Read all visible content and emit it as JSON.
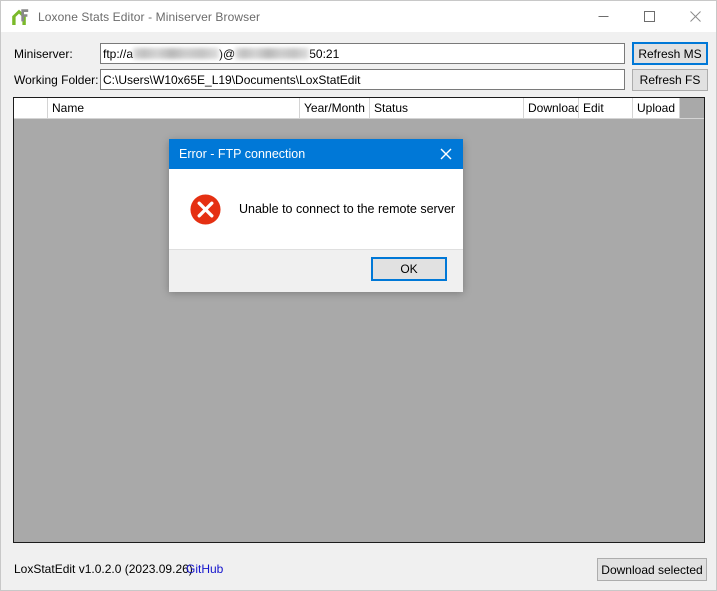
{
  "window": {
    "title": "Loxone Stats Editor - Miniserver Browser",
    "app_icon": "loxone-house-icon",
    "controls": {
      "minimize": "minimize-icon",
      "maximize": "maximize-icon",
      "close": "close-icon"
    }
  },
  "form": {
    "miniserver": {
      "label": "Miniserver:",
      "value_prefix": "ftp://a",
      "value_middle": ")@",
      "value_suffix": "50:21",
      "redacted": true
    },
    "working_folder": {
      "label": "Working Folder:",
      "value": "C:\\Users\\W10x65E_L19\\Documents\\LoxStatEdit"
    },
    "refresh_ms_label": "Refresh MS",
    "refresh_fs_label": "Refresh FS"
  },
  "grid": {
    "columns": [
      {
        "key": "select",
        "label": ""
      },
      {
        "key": "name",
        "label": "Name"
      },
      {
        "key": "year_month",
        "label": "Year/Month"
      },
      {
        "key": "status",
        "label": "Status"
      },
      {
        "key": "download",
        "label": "Download"
      },
      {
        "key": "edit",
        "label": "Edit"
      },
      {
        "key": "upload",
        "label": "Upload"
      }
    ],
    "rows": []
  },
  "dialog": {
    "title": "Error  - FTP connection",
    "message": "Unable to connect to the remote server",
    "icon": "error-circle-icon",
    "close_icon": "close-icon",
    "ok_label": "OK"
  },
  "statusbar": {
    "version_text": "LoxStatEdit v1.0.2.0 (2023.09.26)",
    "github_link": "GitHub",
    "download_selected_label": "Download selected"
  },
  "colors": {
    "accent": "#0078D7",
    "error": "#E53012",
    "window_bg": "#F0F0F0",
    "grid_bg": "#A9A9A9",
    "link": "#1414CC",
    "brand_green": "#7AB929"
  }
}
